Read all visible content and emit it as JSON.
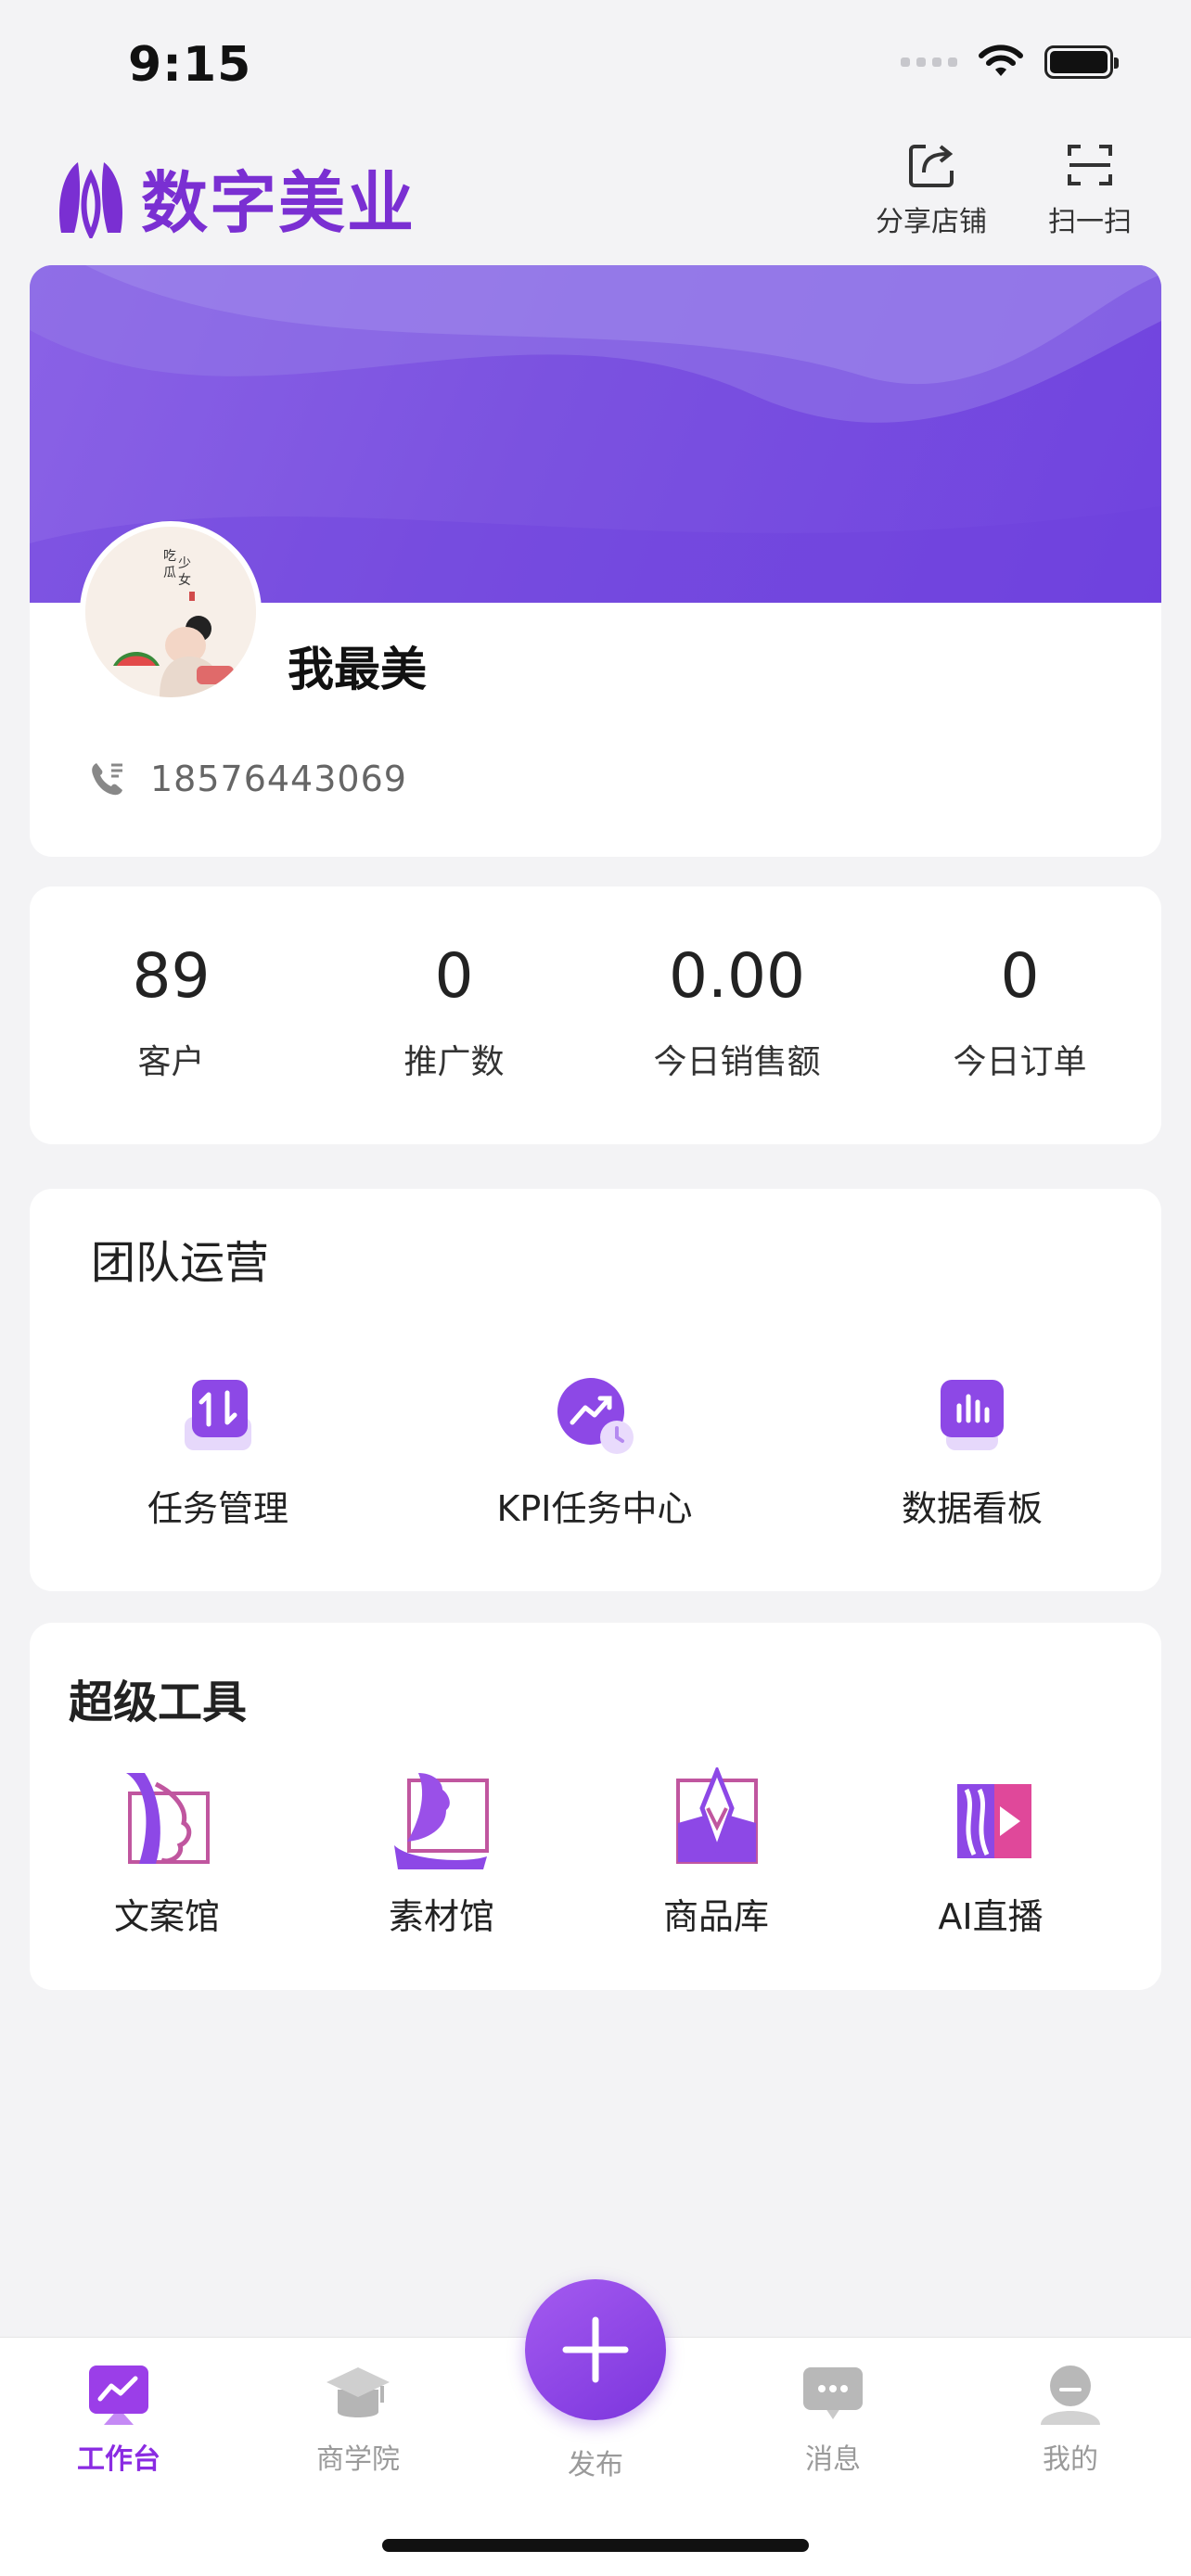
{
  "status_bar": {
    "time": "9:15"
  },
  "header": {
    "logo_text": "数字美业",
    "share_label": "分享店铺",
    "scan_label": "扫一扫"
  },
  "profile": {
    "name": "我最美",
    "phone": "18576443069"
  },
  "stats": [
    {
      "value": "89",
      "label": "客户"
    },
    {
      "value": "0",
      "label": "推广数"
    },
    {
      "value": "0.00",
      "label": "今日销售额"
    },
    {
      "value": "0",
      "label": "今日订单"
    }
  ],
  "team": {
    "title": "团队运营",
    "items": [
      {
        "label": "任务管理",
        "icon": "task-swap-icon"
      },
      {
        "label": "KPI任务中心",
        "icon": "kpi-chart-icon"
      },
      {
        "label": "数据看板",
        "icon": "data-board-icon"
      }
    ]
  },
  "tools": {
    "title": "超级工具",
    "items": [
      {
        "label": "文案馆",
        "icon": "copywriting-icon"
      },
      {
        "label": "素材馆",
        "icon": "material-icon"
      },
      {
        "label": "商品库",
        "icon": "product-icon"
      },
      {
        "label": "AI直播",
        "icon": "ai-live-icon"
      }
    ]
  },
  "tabbar": {
    "items": [
      {
        "label": "工作台",
        "active": true
      },
      {
        "label": "商学院",
        "active": false
      },
      {
        "label": "发布",
        "active": false
      },
      {
        "label": "消息",
        "active": false
      },
      {
        "label": "我的",
        "active": false
      }
    ]
  },
  "colors": {
    "brand": "#7a2fd2",
    "banner": "#7b52e0",
    "active_tab": "#8a2be2"
  }
}
